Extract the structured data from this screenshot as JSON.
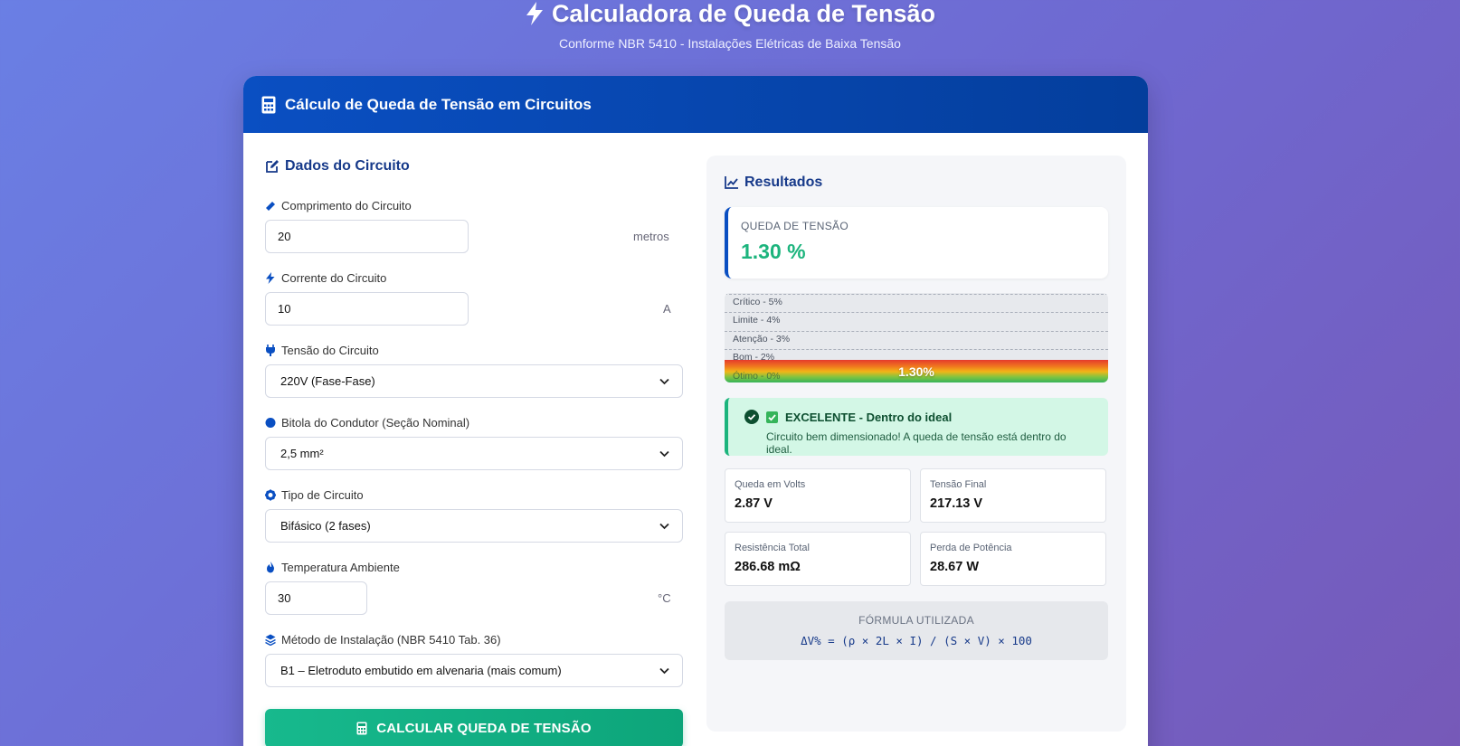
{
  "page": {
    "title": "Calculadora de Queda de Tensão",
    "subtitle": "Conforme NBR 5410 - Instalações Elétricas de Baixa Tensão"
  },
  "card": {
    "header": "Cálculo de Queda de Tensão em Circuitos"
  },
  "form": {
    "section_title": "Dados do Circuito",
    "length": {
      "label": "Comprimento do Circuito",
      "value": "20",
      "unit": "metros"
    },
    "current": {
      "label": "Corrente do Circuito",
      "value": "10",
      "unit": "A"
    },
    "voltage": {
      "label": "Tensão do Circuito",
      "selected": "220V (Fase-Fase)"
    },
    "gauge": {
      "label": "Bitola do Condutor (Seção Nominal)",
      "selected": "2,5 mm²"
    },
    "circuit_type": {
      "label": "Tipo de Circuito",
      "selected": "Bifásico (2 fases)"
    },
    "temperature": {
      "label": "Temperatura Ambiente",
      "value": "30",
      "unit": "°C"
    },
    "install_method": {
      "label": "Método de Instalação (NBR 5410 Tab. 36)",
      "selected": "B1 – Eletroduto embutido em alvenaria (mais comum)"
    },
    "calc_button": "CALCULAR QUEDA DE TENSÃO"
  },
  "results": {
    "title": "Resultados",
    "drop_label": "QUEDA DE TENSÃO",
    "drop_value": "1.30 %",
    "meter": {
      "levels": [
        "Crítico - 5%",
        "Limite - 4%",
        "Atenção - 3%",
        "Bom - 2%",
        "Ótimo - 0%"
      ],
      "current_label": "1.30%",
      "current_value": 1.3
    },
    "status": {
      "title": "EXCELENTE - Dentro do ideal",
      "message": "Circuito bem dimensionado! A queda de tensão está dentro do ideal."
    },
    "metrics": [
      {
        "label": "Queda em Volts",
        "value": "2.87 V"
      },
      {
        "label": "Tensão Final",
        "value": "217.13 V"
      },
      {
        "label": "Resistência Total",
        "value": "286.68 mΩ"
      },
      {
        "label": "Perda de Potência",
        "value": "28.67 W"
      }
    ],
    "formula_label": "FÓRMULA UTILIZADA",
    "formula": "ΔV% = (ρ × 2L × I) / (S × V) × 100"
  },
  "colors": {
    "accent": "#0a4fc2",
    "success": "#1cb47d",
    "button": "#0da57a"
  }
}
